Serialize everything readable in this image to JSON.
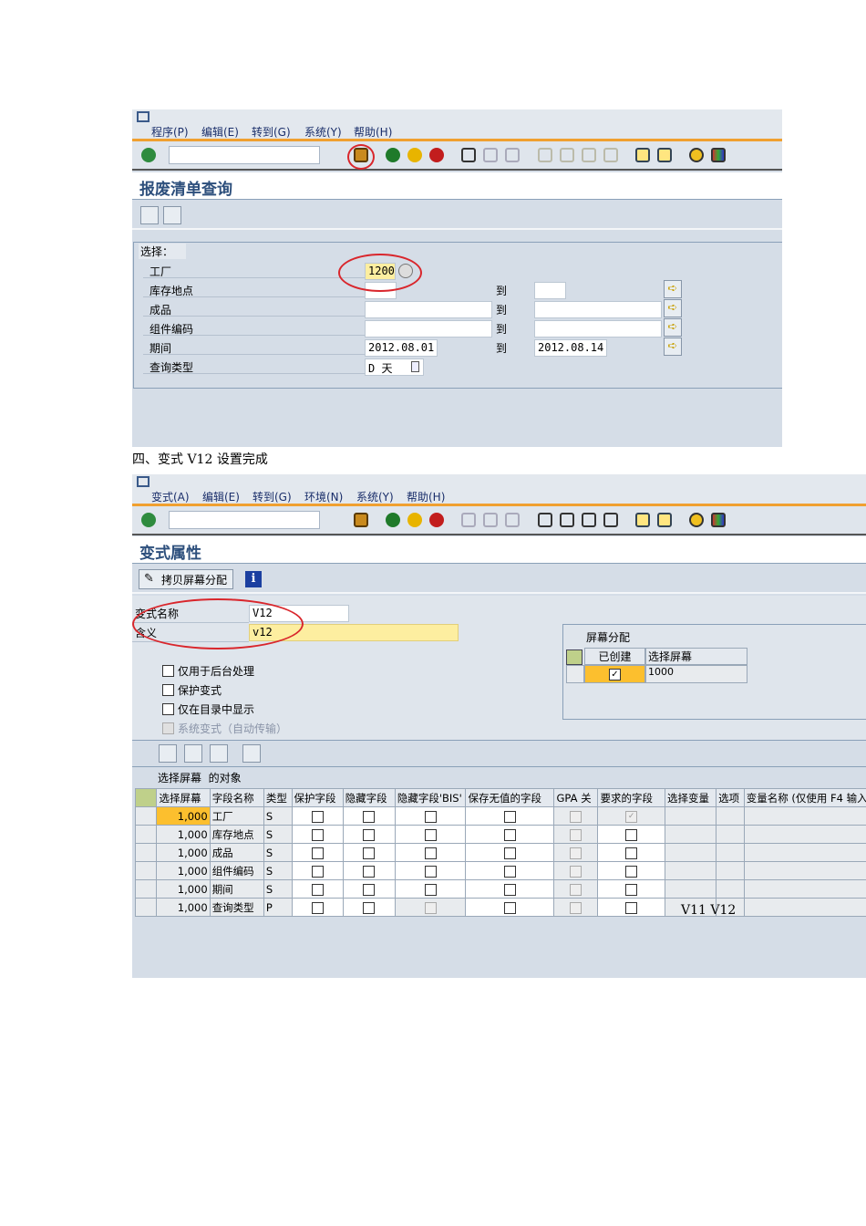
{
  "shot1": {
    "menu": [
      "程序(P)",
      "编辑(E)",
      "转到(G)",
      "系统(Y)",
      "帮助(H)"
    ],
    "title": "报废清单查询",
    "group_label": "选择：",
    "rows": [
      {
        "label": "工厂",
        "from": "1200",
        "to": null
      },
      {
        "label": "库存地点",
        "from": "",
        "to": ""
      },
      {
        "label": "成品",
        "from": "",
        "to": ""
      },
      {
        "label": "组件编码",
        "from": "",
        "to": ""
      },
      {
        "label": "期间",
        "from": "2012.08.01",
        "to": "2012.08.14"
      },
      {
        "label": "查询类型",
        "from": "D 天",
        "to": null
      }
    ],
    "to_label": "到"
  },
  "caption": "四、变式 V12 设置完成",
  "shot2": {
    "menu": [
      "变式(A)",
      "编辑(E)",
      "转到(G)",
      "环境(N)",
      "系统(Y)",
      "帮助(H)"
    ],
    "title": "变式属性",
    "copy_button": "拷贝屏幕分配",
    "variant_name_label": "变式名称",
    "variant_name": "V12",
    "meaning_label": "含义",
    "meaning": "v12",
    "checkboxes": [
      "仅用于后台处理",
      "保护变式",
      "仅在目录中显示",
      "系统变式（自动传输）"
    ],
    "screen_alloc": {
      "title": "屏幕分配",
      "headers": [
        "已创建",
        "选择屏幕"
      ],
      "row": {
        "created": true,
        "screen": "1000"
      }
    },
    "objects_label": "选择屏幕  的对象",
    "table": {
      "headers": [
        "选择屏幕",
        "字段名称",
        "类型",
        "保护字段",
        "隐藏字段",
        "隐藏字段'BIS'",
        "保存无值的字段",
        "GPA 关",
        "要求的字段",
        "选择变量",
        "选项",
        "变量名称 (仅使用 F4 输入)"
      ],
      "rows": [
        {
          "screen": "1,000",
          "field": "工厂",
          "type": "S",
          "req": true
        },
        {
          "screen": "1,000",
          "field": "库存地点",
          "type": "S",
          "req": false
        },
        {
          "screen": "1,000",
          "field": "成品",
          "type": "S",
          "req": false
        },
        {
          "screen": "1,000",
          "field": "组件编码",
          "type": "S",
          "req": false
        },
        {
          "screen": "1,000",
          "field": "期间",
          "type": "S",
          "req": false
        },
        {
          "screen": "1,000",
          "field": "查询类型",
          "type": "P",
          "req": false
        }
      ]
    },
    "annotation": "V11 V12"
  }
}
